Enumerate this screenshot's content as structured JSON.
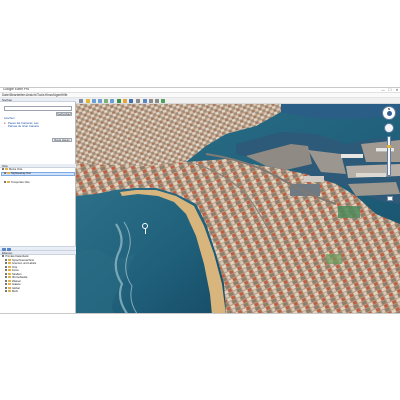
{
  "window": {
    "title": "Google Earth Pro",
    "controls": {
      "minimize": "—",
      "maximize": "☐",
      "close": "✕"
    }
  },
  "menu": [
    "Datei",
    "Bearbeiten",
    "Ansicht",
    "Tools",
    "Hinzufügen",
    "Hilfe"
  ],
  "toolbar": {
    "buttons": [
      "sidebar-icon",
      "placemark-icon",
      "polygon-icon",
      "path-icon",
      "overlay-icon",
      "tour-icon",
      "history-icon",
      "sun-icon",
      "planets-icon",
      "ruler-icon",
      "email-icon",
      "print-icon",
      "save-image-icon",
      "map-icon"
    ]
  },
  "search": {
    "header": "Suchen",
    "input_value": "",
    "history_label": "Suchverlauf",
    "clear_label": "Löschen",
    "result": "Paseo las Canteras, Las Palmas de Gran Canaria",
    "get_directions": "Route planen"
  },
  "places": {
    "header": "Orte",
    "items": [
      {
        "label": "Meine Orte",
        "checked": true,
        "selected": false
      },
      {
        "label": "Sightseeing-Tour",
        "checked": true,
        "selected": false
      },
      {
        "label": "Temporäre Orte",
        "checked": true,
        "selected": false
      }
    ],
    "temp_label": "Temporäre Orte"
  },
  "layers": {
    "header": "Ebenen",
    "primary": "Primäre Datenbank",
    "items": [
      "Sprachverzeichnis",
      "Grenzen und Labels",
      "Orte",
      "Fotos",
      "Straßen",
      "3D-Gebäude",
      "Wasser",
      "Galerie",
      "Global",
      "Mehr"
    ]
  },
  "map": {
    "north_label": "N",
    "colors": {
      "sea": "#1f5f7a",
      "beach": "#d2b07a",
      "city": "#b59f86",
      "port_water": "#2c5a78"
    }
  }
}
